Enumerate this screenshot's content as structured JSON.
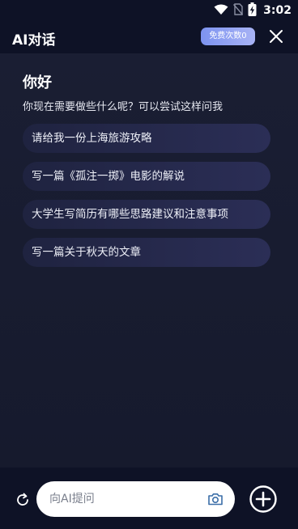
{
  "status_bar": {
    "time": "3:02",
    "icons": [
      "wifi-icon",
      "no-sim-icon",
      "battery-charging-icon"
    ]
  },
  "header": {
    "title": "AI对话",
    "quota_badge": "免费次数0",
    "close_icon": "close-icon"
  },
  "main": {
    "greeting": "你好",
    "subtitle": "你现在需要做些什么呢？可以尝试这样问我",
    "suggestions": [
      "请给我一份上海旅游攻略",
      "写一篇《孤注一掷》电影的解说",
      "大学生写简历有哪些思路建议和注意事项",
      "写一篇关于秋天的文章"
    ]
  },
  "bottom_bar": {
    "refresh_icon": "refresh-icon",
    "input_placeholder": "向AI提问",
    "input_value": "",
    "camera_icon": "camera-icon",
    "add_icon": "plus-circle-icon"
  },
  "colors": {
    "header_bg": "#0e1226",
    "content_bg": "#181c30",
    "badge_bg": "#8ea0f2",
    "suggestion_bg": "#23274a",
    "accent_blue": "#3b6ea8"
  }
}
